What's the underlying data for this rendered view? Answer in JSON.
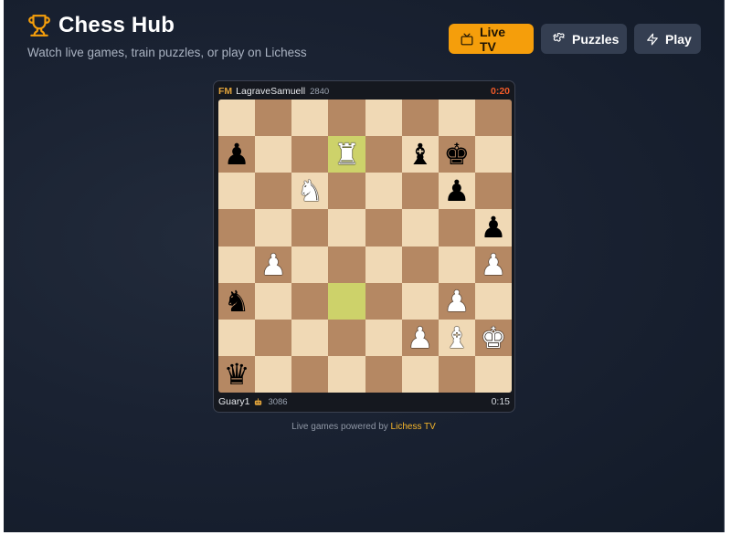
{
  "app": {
    "title": "Chess Hub",
    "subtitle": "Watch live games, train puzzles, or play on Lichess",
    "icon": "trophy-icon",
    "accent": "#f59e0b"
  },
  "nav": {
    "live_tv": "Live TV",
    "puzzles": "Puzzles",
    "play": "Play"
  },
  "game": {
    "top_player": {
      "title": "FM",
      "name": "LagraveSamuell",
      "rating": "2840",
      "clock": "0:20"
    },
    "bottom_player": {
      "name": "Guary1",
      "rating": "3086",
      "clock": "0:15",
      "badge": "bot-icon"
    },
    "highlight_squares": [
      "d7",
      "d3"
    ],
    "position": [
      [
        "",
        "",
        "",
        "",
        "",
        "",
        "",
        ""
      ],
      [
        "p",
        "",
        "",
        "R",
        "",
        "b",
        "k",
        ""
      ],
      [
        "",
        "",
        "N",
        "",
        "",
        "",
        "p",
        ""
      ],
      [
        "",
        "",
        "",
        "",
        "",
        "",
        "",
        "p"
      ],
      [
        "",
        "P",
        "",
        "",
        "",
        "",
        "",
        "P"
      ],
      [
        "n",
        "",
        "",
        "",
        "",
        "",
        "P",
        ""
      ],
      [
        "",
        "",
        "",
        "",
        "",
        "P",
        "B",
        "K"
      ],
      [
        "q",
        "",
        "",
        "",
        "",
        "",
        "",
        ""
      ]
    ]
  },
  "footer": {
    "prefix": "Live games powered by",
    "link": "Lichess TV"
  }
}
